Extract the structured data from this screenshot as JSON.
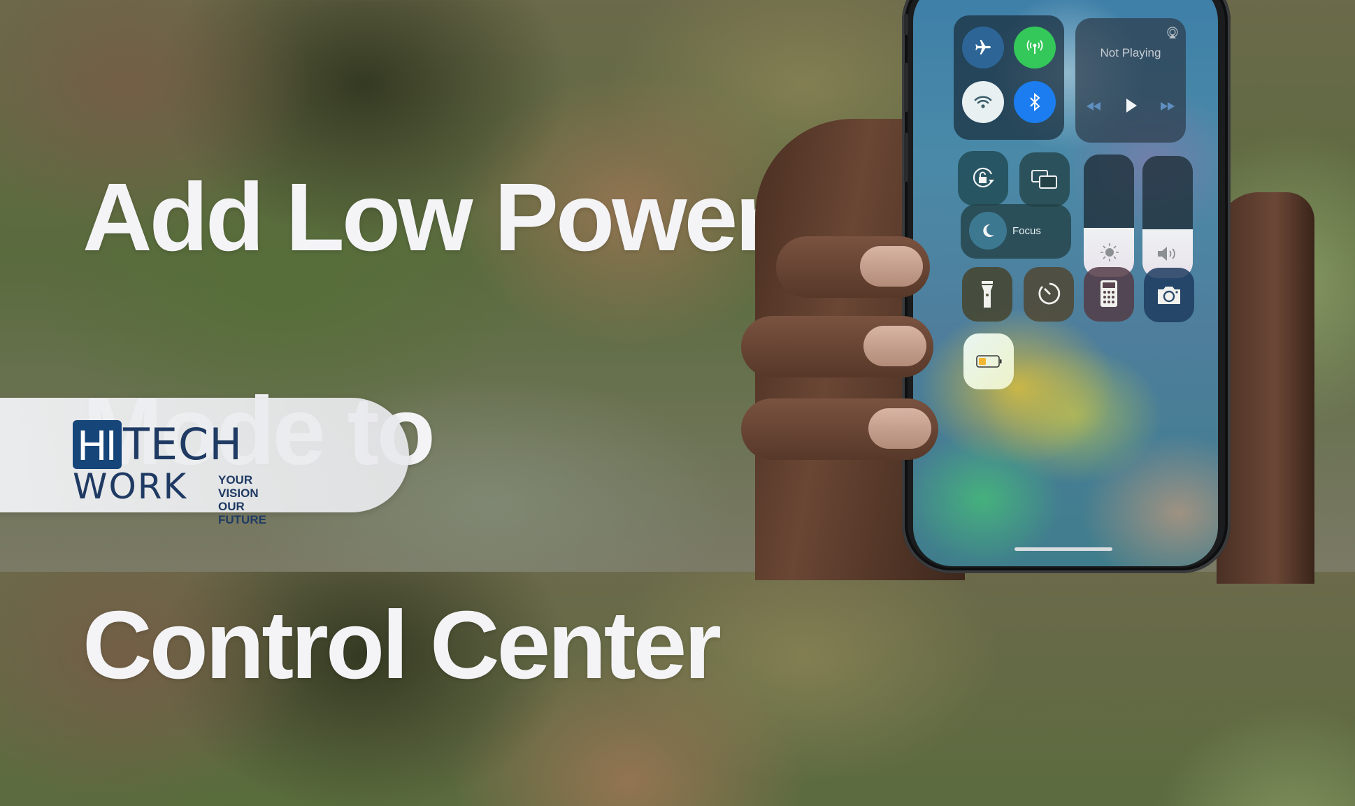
{
  "headline": {
    "lines": [
      "Add Low Power",
      "Mode to",
      "Control Center"
    ]
  },
  "logo": {
    "hi": "HI",
    "tech": "TECH",
    "work": "WORK",
    "tagline_line1": "YOUR VISION",
    "tagline_line2": "OUR FUTURE",
    "brand_color": "#164579"
  },
  "control_center": {
    "connectivity": {
      "airplane_mode": {
        "icon": "airplane-icon",
        "on": false
      },
      "cellular_data": {
        "icon": "antenna-icon",
        "on": true,
        "color": "#34c759"
      },
      "wifi": {
        "icon": "wifi-icon",
        "on": true
      },
      "bluetooth": {
        "icon": "bluetooth-icon",
        "on": true,
        "color": "#1c7df0"
      }
    },
    "now_playing": {
      "status": "Not Playing",
      "airplay_icon": "airplay-icon",
      "controls": [
        "rewind-icon",
        "play-icon",
        "fast-forward-icon"
      ]
    },
    "orientation_lock": {
      "icon": "orientation-lock-icon"
    },
    "screen_mirroring": {
      "icon": "screen-mirroring-icon"
    },
    "focus": {
      "label": "Focus",
      "icon": "moon-icon"
    },
    "brightness": {
      "icon": "sun-icon",
      "level_percent": 40
    },
    "volume": {
      "icon": "speaker-icon",
      "level_percent": 40
    },
    "shortcuts": [
      "flashlight-icon",
      "timer-icon",
      "calculator-icon",
      "camera-icon"
    ],
    "low_power_mode": {
      "icon": "battery-icon",
      "on": true,
      "battery_color": "#f2b631"
    }
  }
}
